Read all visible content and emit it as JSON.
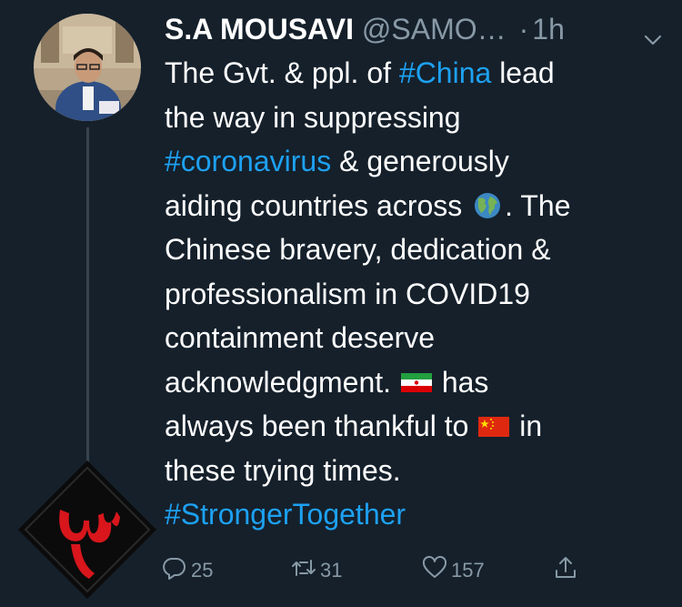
{
  "tweet": {
    "display_name": "S.A MOUSAVI",
    "handle": "@SAMO…",
    "dot": "·",
    "time": "1h",
    "lines": [
      {
        "segments": [
          {
            "t": "The Gvt. & ppl. of "
          },
          {
            "t": "#China",
            "tag": true
          },
          {
            "t": " lead"
          }
        ]
      },
      {
        "segments": [
          {
            "t": "the way in suppressing"
          }
        ]
      },
      {
        "segments": [
          {
            "t": "#coronavirus",
            "tag": true
          },
          {
            "t": " & generously"
          }
        ]
      },
      {
        "segments": [
          {
            "t": "aiding countries across "
          },
          {
            "emoji": "globe"
          },
          {
            "t": ". The"
          }
        ]
      },
      {
        "segments": [
          {
            "t": "Chinese bravery, dedication &"
          }
        ]
      },
      {
        "segments": [
          {
            "t": "professionalism in COVID19"
          }
        ]
      },
      {
        "segments": [
          {
            "t": "containment deserve"
          }
        ]
      },
      {
        "segments": [
          {
            "t": "acknowledgment. "
          },
          {
            "emoji": "iran-flag"
          },
          {
            "t": " has"
          }
        ]
      },
      {
        "segments": [
          {
            "t": "always been thankful to "
          },
          {
            "emoji": "china-flag"
          },
          {
            "t": " in"
          }
        ]
      },
      {
        "segments": [
          {
            "t": "these trying times."
          }
        ]
      },
      {
        "segments": [
          {
            "t": "#StrongerTogether",
            "tag": true
          }
        ]
      }
    ]
  },
  "actions": {
    "reply_count": "25",
    "retweet_count": "31",
    "like_count": "157"
  },
  "icons": {
    "reply": "reply-icon",
    "retweet": "retweet-icon",
    "like": "heart-icon",
    "share": "share-icon",
    "menu": "chevron-down-icon"
  },
  "colors": {
    "background": "#15202b",
    "text": "#ffffff",
    "muted": "#8899a6",
    "accent": "#1da1f2"
  }
}
